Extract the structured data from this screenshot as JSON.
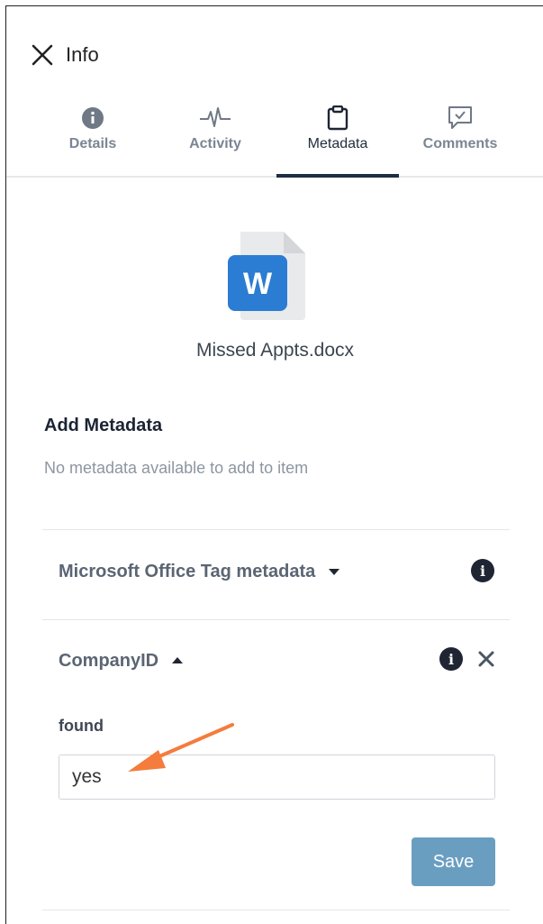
{
  "header": {
    "title": "Info"
  },
  "tabs": [
    {
      "label": "Details",
      "icon": "info-circle-icon",
      "active": false
    },
    {
      "label": "Activity",
      "icon": "activity-pulse-icon",
      "active": false
    },
    {
      "label": "Metadata",
      "icon": "clipboard-icon",
      "active": true
    },
    {
      "label": "Comments",
      "icon": "comment-check-icon",
      "active": false
    }
  ],
  "file": {
    "name": "Missed Appts.docx",
    "icon_letter": "W",
    "icon": "word-document-icon"
  },
  "add_metadata": {
    "title": "Add Metadata",
    "subtitle": "No metadata available to add to item"
  },
  "templates": [
    {
      "label": "Microsoft Office Tag metadata",
      "expanded": false
    },
    {
      "label": "CompanyID",
      "expanded": true,
      "field": {
        "label": "found",
        "value": "yes"
      },
      "save_label": "Save"
    }
  ],
  "colors": {
    "accent_tab_underline": "#1f2d44",
    "save_button": "#6a9ec1",
    "word_blue": "#2b7cd3",
    "annotation_arrow": "#f47c3c"
  }
}
